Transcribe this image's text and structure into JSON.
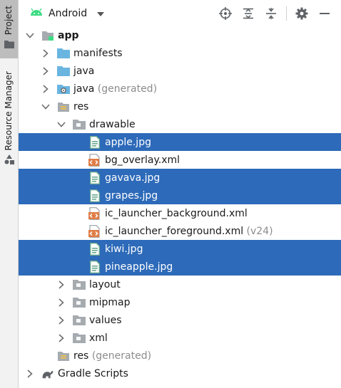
{
  "sidebar": {
    "project_label": "Project",
    "resource_manager_label": "Resource Manager"
  },
  "header": {
    "view_label": "Android",
    "tools": [
      "locate-icon",
      "expand-all-icon",
      "collapse-all-icon",
      "gear-icon",
      "minimize-icon"
    ]
  },
  "colors": {
    "selection": "#2d6ab9",
    "folder": "#69b5e0",
    "xml_icon": "#e07d46",
    "android_green": "#3ddc84"
  },
  "tree": [
    {
      "label": "app",
      "bold": true,
      "depth": 0,
      "arrow": "down",
      "icon": "module-folder-icon"
    },
    {
      "label": "manifests",
      "depth": 1,
      "arrow": "right",
      "icon": "folder-icon"
    },
    {
      "label": "java",
      "depth": 1,
      "arrow": "right",
      "icon": "folder-icon"
    },
    {
      "label": "java",
      "extra": "(generated)",
      "depth": 1,
      "arrow": "right",
      "icon": "generated-folder-icon"
    },
    {
      "label": "res",
      "depth": 1,
      "arrow": "down",
      "icon": "res-folder-icon"
    },
    {
      "label": "drawable",
      "depth": 2,
      "arrow": "down",
      "icon": "gray-folder-icon"
    },
    {
      "label": "apple.jpg",
      "depth": 3,
      "icon": "image-file-icon",
      "selected": true
    },
    {
      "label": "bg_overlay.xml",
      "depth": 3,
      "icon": "xml-file-icon"
    },
    {
      "label": "gavava.jpg",
      "depth": 3,
      "icon": "image-file-icon",
      "selected": true
    },
    {
      "label": "grapes.jpg",
      "depth": 3,
      "icon": "image-file-icon",
      "selected": true
    },
    {
      "label": "ic_launcher_background.xml",
      "depth": 3,
      "icon": "xml-file-icon"
    },
    {
      "label": "ic_launcher_foreground.xml",
      "extra": "(v24)",
      "depth": 3,
      "icon": "xml-file-icon"
    },
    {
      "label": "kiwi.jpg",
      "depth": 3,
      "icon": "image-file-icon",
      "selected": true
    },
    {
      "label": "pineapple.jpg",
      "depth": 3,
      "icon": "image-file-icon",
      "selected": true
    },
    {
      "label": "layout",
      "depth": 2,
      "arrow": "right",
      "icon": "gray-folder-icon"
    },
    {
      "label": "mipmap",
      "depth": 2,
      "arrow": "right",
      "icon": "gray-folder-icon"
    },
    {
      "label": "values",
      "depth": 2,
      "arrow": "right",
      "icon": "gray-folder-icon"
    },
    {
      "label": "xml",
      "depth": 2,
      "arrow": "right",
      "icon": "gray-folder-icon"
    },
    {
      "label": "res",
      "extra": "(generated)",
      "depth": 1,
      "icon": "res-folder-icon"
    },
    {
      "label": "Gradle Scripts",
      "depth": 0,
      "arrow": "right",
      "icon": "gradle-icon"
    }
  ]
}
